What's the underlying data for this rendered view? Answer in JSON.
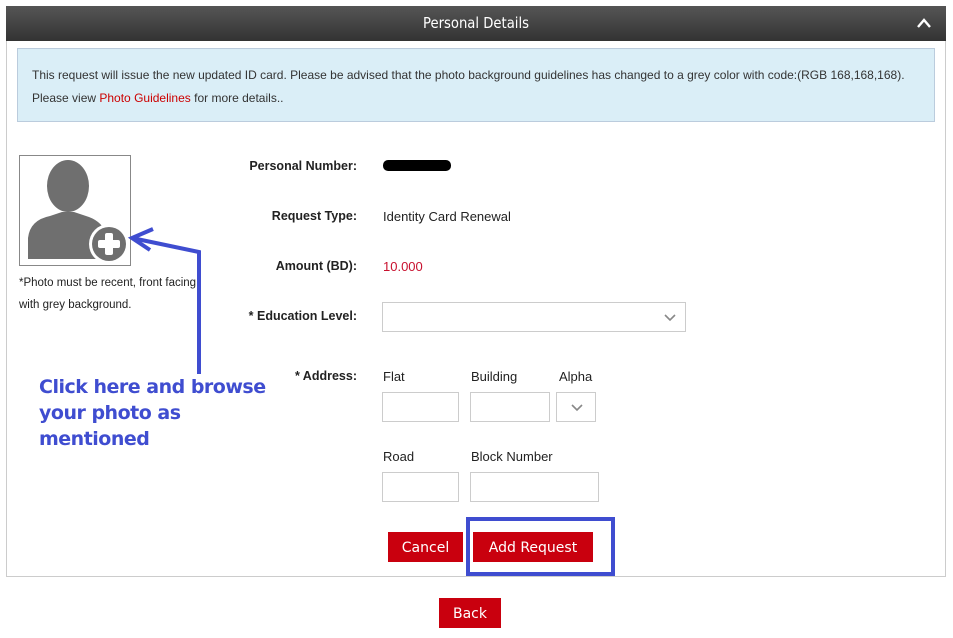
{
  "header": {
    "title": "Personal Details",
    "collapse_icon": "chevron-up-icon"
  },
  "notice": {
    "text_before": "This request will issue the new updated ID card. Please be advised that the photo background guidelines has changed to a grey color with code:(RGB 168,168,168). Please view ",
    "link_text": "Photo Guidelines",
    "text_after": " for more details.."
  },
  "photo": {
    "icon": "add-photo-avatar-icon",
    "note": "*Photo must be recent, front facing with grey background."
  },
  "form": {
    "personal_number": {
      "label": "Personal Number:",
      "value": "[redacted]"
    },
    "request_type": {
      "label": "Request Type:",
      "value": "Identity Card Renewal"
    },
    "amount": {
      "label": "Amount (BD):",
      "value": "10.000"
    },
    "education_level": {
      "label": "* Education Level:",
      "selected": ""
    },
    "address": {
      "label": "* Address:",
      "flat": {
        "label": "Flat",
        "value": ""
      },
      "building": {
        "label": "Building",
        "value": ""
      },
      "alpha": {
        "label": "Alpha",
        "selected": ""
      },
      "road": {
        "label": "Road",
        "value": ""
      },
      "block_number": {
        "label": "Block Number",
        "value": ""
      }
    }
  },
  "buttons": {
    "cancel": "Cancel",
    "add_request": "Add Request",
    "back": "Back"
  },
  "annotation": {
    "text": "Click here and browse your photo as mentioned"
  },
  "colors": {
    "accent_red": "#c9000e",
    "annotation_blue": "#3f4dd0",
    "info_bg": "#daeef7"
  }
}
